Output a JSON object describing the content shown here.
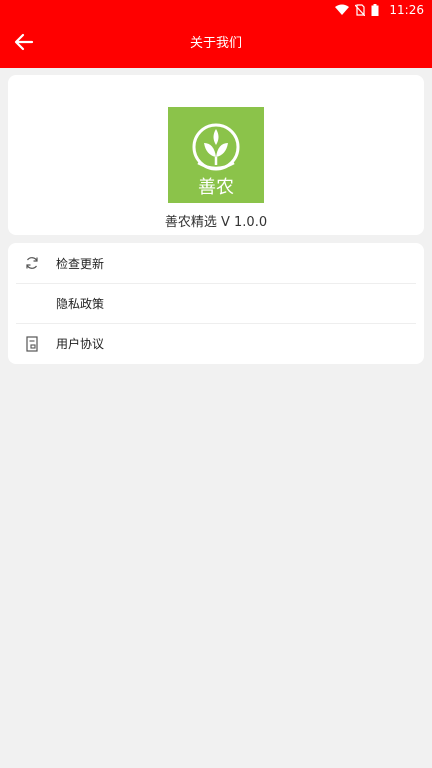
{
  "status_bar": {
    "time": "11:26"
  },
  "header": {
    "title": "关于我们"
  },
  "about": {
    "logo_text": "善农",
    "version": "善农精选 V 1.0.0"
  },
  "menu": [
    {
      "label": "检查更新",
      "icon": "refresh-icon"
    },
    {
      "label": "隐私政策",
      "icon": ""
    },
    {
      "label": "用户协议",
      "icon": "document-icon"
    }
  ],
  "colors": {
    "primary": "#ff0000",
    "logo_bg": "#8bc34a",
    "background": "#f1f1f1"
  }
}
